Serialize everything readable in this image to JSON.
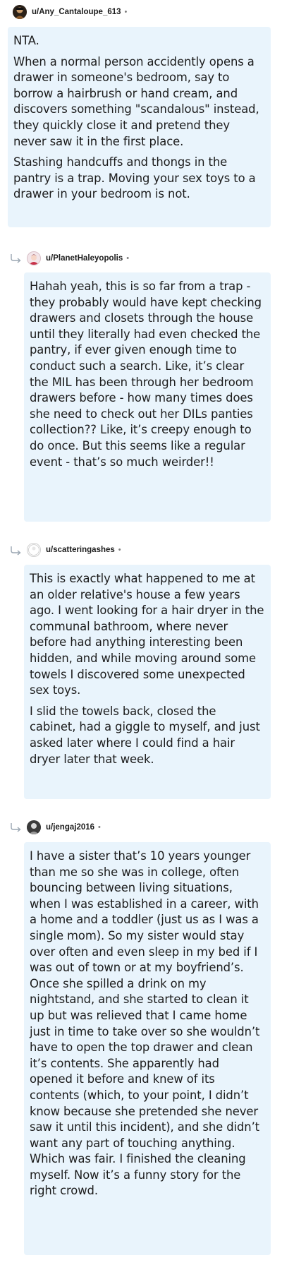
{
  "comments": [
    {
      "username": "u/Any_Cantaloupe_613",
      "separator": "•",
      "avatar_icon": "user-avatar-icon",
      "paragraphs": [
        "NTA.",
        "When a normal person accidently opens a drawer in someone's bedroom, say to borrow a hairbrush or hand cream, and discovers something \"scandalous\" instead, they quickly close it and pretend they never saw it in the first place.",
        "Stashing handcuffs and thongs in the pantry is a trap. Moving your sex toys to a drawer in your bedroom is not."
      ]
    },
    {
      "username": "u/PlanetHaleyopolis",
      "separator": "•",
      "avatar_icon": "user-avatar-icon",
      "paragraphs": [
        "Hahah yeah, this is so far from a trap - they probably would have kept checking drawers and closets through the house until they literally had even checked the pantry, if ever given enough time to conduct such a search. Like, it’s clear the MIL has been through her bedroom drawers before - how many times does she need to check out her DILs panties collection?? Like, it’s creepy enough to do once. But this seems like a regular event - that’s so much weirder!!"
      ]
    },
    {
      "username": "u/scatteringashes",
      "separator": "•",
      "avatar_icon": "user-avatar-icon",
      "paragraphs": [
        "This is exactly what happened to me at an older relative's house a few years ago. I went looking for a hair dryer in the communal bathroom, where never before had anything interesting been hidden, and while moving around some towels I discovered some unexpected sex toys.",
        "I slid the towels back, closed the cabinet, had a giggle to myself, and just asked later where I could find a hair dryer later that week."
      ]
    },
    {
      "username": "u/jengaj2016",
      "separator": "•",
      "avatar_icon": "user-avatar-icon",
      "paragraphs": [
        "I have a sister that’s 10 years younger than me so she was in college, often bouncing between living situations, when I was established in a career, with a home and a toddler (just us as I was a single mom). So my sister would stay over often and even sleep in my bed if I was out of town or at my boyfriend’s. Once she spilled a drink on my nightstand, and she started to clean it up but was relieved that I came home just in time to take over so she wouldn’t have to open the top drawer and clean it’s contents. She apparently had opened it before and knew of its contents (which, to your point, I didn’t know because she pretended she never saw it until this incident), and she didn’t want any part of touching anything. Which was fair. I finished the cleaning myself. Now it’s a funny story for the right crowd."
      ]
    }
  ],
  "colors": {
    "bubble_background": "#e9f4fc",
    "text": "#1c1c1c",
    "meta": "#7c7c7c"
  }
}
